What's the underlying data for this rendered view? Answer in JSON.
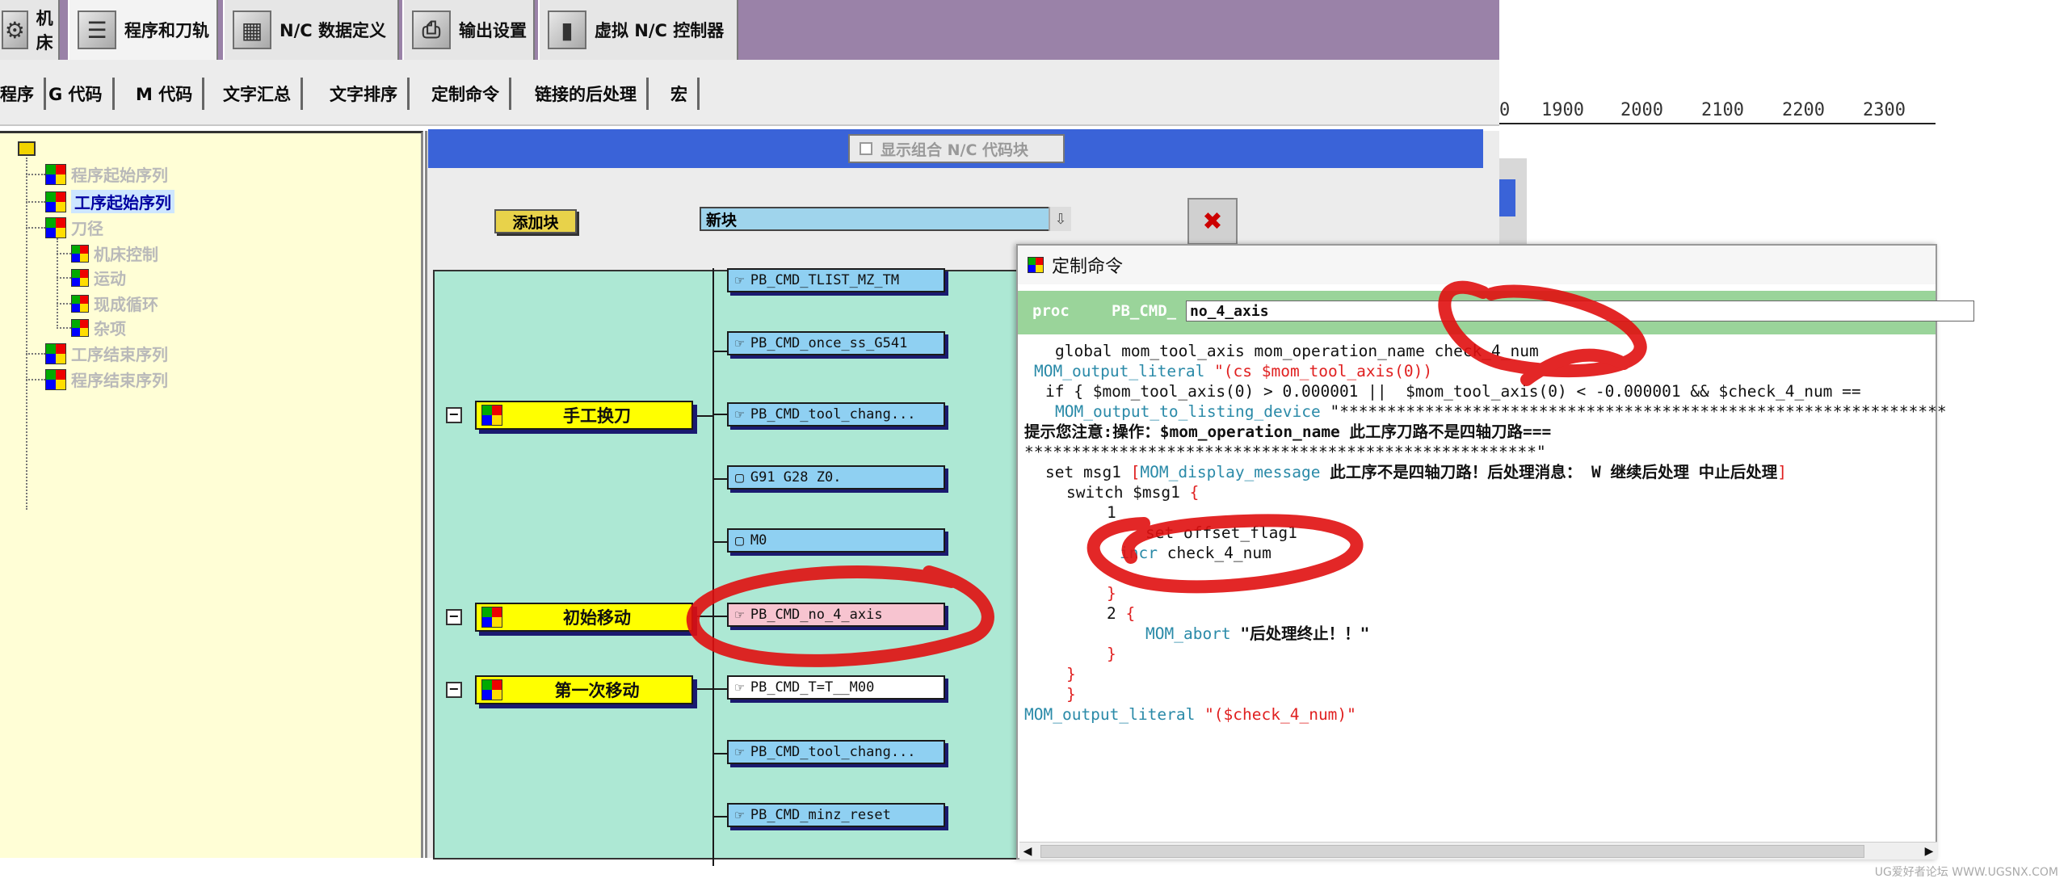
{
  "top_tabs": [
    {
      "label": "机床",
      "icon": "machine-icon"
    },
    {
      "label": "程序和刀轨",
      "icon": "program-toolpath-icon"
    },
    {
      "label": "N/C 数据定义",
      "icon": "nc-data-icon"
    },
    {
      "label": "输出设置",
      "icon": "printer-icon"
    },
    {
      "label": "虚拟 N/C 控制器",
      "icon": "virtual-controller-icon"
    }
  ],
  "sub_tabs": [
    "程序",
    "G 代码",
    "M 代码",
    "文字汇总",
    "文字排序",
    "定制命令",
    "链接的后处理",
    "宏"
  ],
  "tree": {
    "items": [
      {
        "label": "程序起始序列"
      },
      {
        "label": "工序起始序列",
        "selected": true
      },
      {
        "label": "刀径"
      },
      {
        "label": "机床控制"
      },
      {
        "label": "运动"
      },
      {
        "label": "现成循环"
      },
      {
        "label": "杂项"
      },
      {
        "label": "工序结束序列"
      },
      {
        "label": "程序结束序列"
      }
    ]
  },
  "editor": {
    "show_combined_label": "显示组合 N/C 代码块",
    "add_block_label": "添加块",
    "new_block_value": "新块"
  },
  "groups": [
    {
      "label": "手工换刀"
    },
    {
      "label": "初始移动"
    },
    {
      "label": "第一次移动"
    }
  ],
  "blocks": [
    {
      "label": "PB_CMD_TLIST_MZ_TM"
    },
    {
      "label": "PB_CMD_once_ss_G541"
    },
    {
      "label": "PB_CMD_tool_chang..."
    },
    {
      "label": "G91 G28 Z0."
    },
    {
      "label": "M0"
    },
    {
      "label": "PB_CMD_no_4_axis"
    },
    {
      "label": "PB_CMD_T=T__M00"
    },
    {
      "label": "PB_CMD_tool_chang..."
    },
    {
      "label": "PB_CMD_minz_reset"
    }
  ],
  "ruler_ticks": [
    "0",
    "1900",
    "2000",
    "2100",
    "2200",
    "2300"
  ],
  "dialog": {
    "title": "定制命令",
    "proc_kw": "proc",
    "proc_prefix": "PB_CMD_",
    "proc_name": "no_4_axis",
    "brace_a": "{ }",
    "brace_b": "{",
    "code": {
      "l1": "global mom_tool_axis mom_operation_name check_4_num",
      "l2a": "MOM_output_literal ",
      "l2b": "\"(cs $mom_tool_axis(0))",
      "l3": "if { $mom_tool_axis(0) > 0.000001 ||  $mom_tool_axis(0) < -0.000001 && $check_4_num ==",
      "l4a": "MOM_output_to_listing_device ",
      "l4b": "\"****************************************************************",
      "l5": "提示您注意:操作：$mom_operation_name 此工序刀路不是四轴刀路===",
      "l6": "******************************************************\"",
      "l7a": "set msg1 ",
      "l7b": "[",
      "l7c": "MOM_display_message ",
      "l7d": "此工序不是四轴刀路！后处理消息： W 继续后处理 中止后处理",
      "l7e": "]",
      "l8a": "switch $msg1 ",
      "l8b": "{",
      "l9": "1 ",
      "l10": "set offset_flag1",
      "l11a": "incr",
      "l11b": " check_4_num",
      "l12": "}",
      "l13a": "2 ",
      "l13b": "{",
      "l14a": "MOM_abort ",
      "l14b": "\"后处理终止！！\"",
      "l15": "}",
      "l16": "}",
      "l17": "}",
      "l18a": "MOM_output_literal ",
      "l18b": "\"($check_4_num)\""
    }
  },
  "watermark": "UG爱好者论坛 WWW.UGSNX.COM",
  "colors": {
    "top_tab_bar": "#9a82a8",
    "tree_bg": "#fffed6",
    "block_bg": "#8fd0f2",
    "group_bg": "#ffff00",
    "canvas_bg": "#ade8d4",
    "proc_bar": "#9ad49a",
    "annotation_red": "#e01010"
  }
}
